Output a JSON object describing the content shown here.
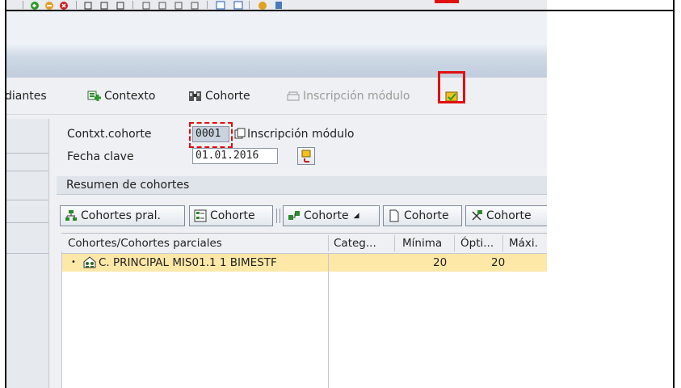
{
  "toolbar": {
    "icons": [
      "back-icon",
      "exit-icon",
      "cancel-icon",
      "print-icon",
      "find-icon",
      "find-next-icon",
      "first-page-icon",
      "prev-page-icon",
      "next-page-icon",
      "last-page-icon",
      "new-session-icon",
      "shortcut-icon",
      "help-icon",
      "layout-icon"
    ]
  },
  "app_toolbar": {
    "item1": "diantes",
    "contexto": "Contexto",
    "cohorte": "Cohorte",
    "inscripcion": "Inscripción módulo"
  },
  "form": {
    "contxt_label": "Contxt.cohorte",
    "contxt_value": "0001",
    "contxt_desc": "Inscripción módulo",
    "fecha_label": "Fecha clave",
    "fecha_value": "01.01.2016"
  },
  "group": {
    "title": "Resumen de cohortes",
    "buttons": {
      "cohortes_pral": "Cohortes pral.",
      "cohorte1": "Cohorte",
      "cohorte2": "Cohorte",
      "cohorte3": "Cohorte",
      "cohorte4": "Cohorte"
    }
  },
  "table": {
    "columns": [
      "Cohortes/Cohortes parciales",
      "Categ...",
      "Mínima",
      "Ópti...",
      "Máxi."
    ],
    "rows": [
      {
        "name": "C. PRINCIPAL MIS01.1 1 BIMESTF",
        "categ": "",
        "minima": "20",
        "optima": "20",
        "maxima": ""
      }
    ]
  },
  "colors": {
    "highlight": "#e01010",
    "row_selected": "#fde8a8"
  }
}
